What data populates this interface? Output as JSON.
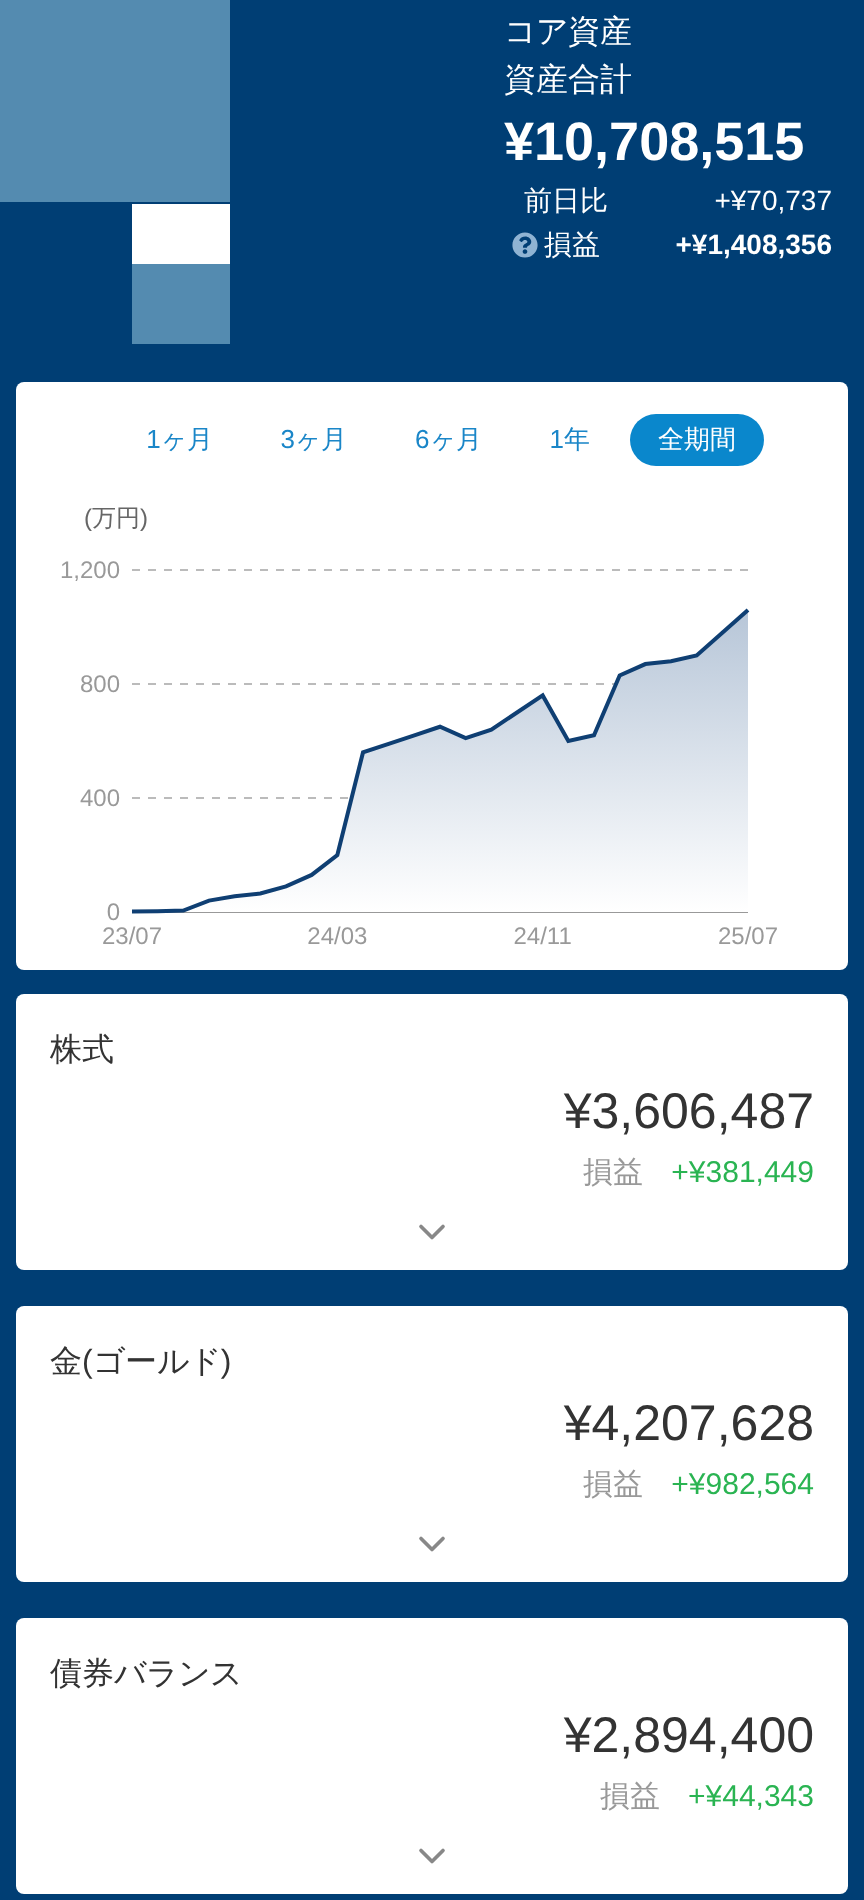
{
  "header": {
    "title": "コア資産",
    "total_label": "資産合計",
    "total": "¥10,708,515",
    "rows": [
      {
        "kind": "plain",
        "label": "前日比",
        "value": "+¥70,737"
      },
      {
        "kind": "help",
        "label": "損益",
        "value": "+¥1,408,356"
      }
    ]
  },
  "period_tabs": [
    {
      "label": "1ヶ月",
      "selected": false
    },
    {
      "label": "3ヶ月",
      "selected": false
    },
    {
      "label": "6ヶ月",
      "selected": false
    },
    {
      "label": "1年",
      "selected": false
    },
    {
      "label": "全期間",
      "selected": true
    }
  ],
  "chart": {
    "chart_data": {
      "type": "area",
      "ylabel": "(万円)",
      "categories": [
        "23/07",
        null,
        null,
        null,
        null,
        null,
        null,
        null,
        "24/03",
        null,
        null,
        null,
        null,
        null,
        null,
        null,
        "24/11",
        null,
        null,
        null,
        null,
        null,
        null,
        null,
        "25/07"
      ],
      "series": [
        {
          "color": "#0f3f73",
          "values": [
            2,
            3,
            5,
            40,
            55,
            65,
            90,
            130,
            200,
            560,
            590,
            620,
            650,
            610,
            640,
            700,
            760,
            600,
            620,
            830,
            870,
            880,
            900,
            980,
            1060
          ]
        }
      ],
      "ylim": [
        0,
        1200
      ],
      "yticks": [
        {
          "value": 0,
          "label": "0"
        },
        {
          "value": 400,
          "label": "400"
        },
        {
          "value": 800,
          "label": "800"
        },
        {
          "value": 1200,
          "label": "1,200"
        }
      ]
    }
  },
  "assets": [
    {
      "name": "株式",
      "amount": "¥3,606,487",
      "pl_label": "損益",
      "pl": "+¥381,449"
    },
    {
      "name": "金(ゴールド)",
      "amount": "¥4,207,628",
      "pl_label": "損益",
      "pl": "+¥982,564"
    },
    {
      "name": "債券バランス",
      "amount": "¥2,894,400",
      "pl_label": "損益",
      "pl": "+¥44,343"
    }
  ]
}
